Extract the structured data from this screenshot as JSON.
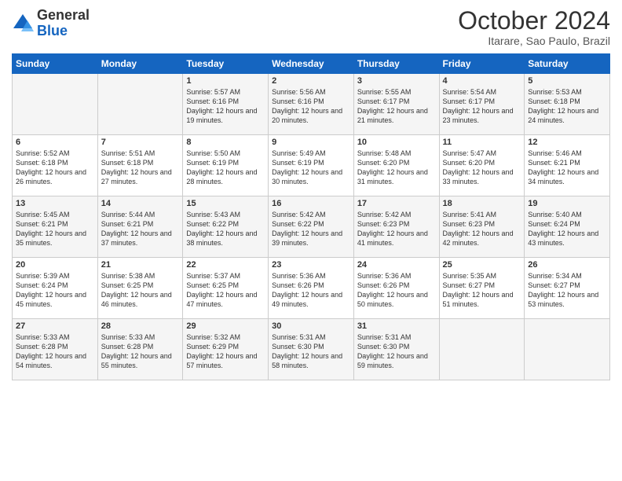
{
  "logo": {
    "general": "General",
    "blue": "Blue"
  },
  "title": "October 2024",
  "location": "Itarare, Sao Paulo, Brazil",
  "days_of_week": [
    "Sunday",
    "Monday",
    "Tuesday",
    "Wednesday",
    "Thursday",
    "Friday",
    "Saturday"
  ],
  "weeks": [
    [
      {
        "day": "",
        "text": ""
      },
      {
        "day": "",
        "text": ""
      },
      {
        "day": "1",
        "text": "Sunrise: 5:57 AM\nSunset: 6:16 PM\nDaylight: 12 hours and 19 minutes."
      },
      {
        "day": "2",
        "text": "Sunrise: 5:56 AM\nSunset: 6:16 PM\nDaylight: 12 hours and 20 minutes."
      },
      {
        "day": "3",
        "text": "Sunrise: 5:55 AM\nSunset: 6:17 PM\nDaylight: 12 hours and 21 minutes."
      },
      {
        "day": "4",
        "text": "Sunrise: 5:54 AM\nSunset: 6:17 PM\nDaylight: 12 hours and 23 minutes."
      },
      {
        "day": "5",
        "text": "Sunrise: 5:53 AM\nSunset: 6:18 PM\nDaylight: 12 hours and 24 minutes."
      }
    ],
    [
      {
        "day": "6",
        "text": "Sunrise: 5:52 AM\nSunset: 6:18 PM\nDaylight: 12 hours and 26 minutes."
      },
      {
        "day": "7",
        "text": "Sunrise: 5:51 AM\nSunset: 6:18 PM\nDaylight: 12 hours and 27 minutes."
      },
      {
        "day": "8",
        "text": "Sunrise: 5:50 AM\nSunset: 6:19 PM\nDaylight: 12 hours and 28 minutes."
      },
      {
        "day": "9",
        "text": "Sunrise: 5:49 AM\nSunset: 6:19 PM\nDaylight: 12 hours and 30 minutes."
      },
      {
        "day": "10",
        "text": "Sunrise: 5:48 AM\nSunset: 6:20 PM\nDaylight: 12 hours and 31 minutes."
      },
      {
        "day": "11",
        "text": "Sunrise: 5:47 AM\nSunset: 6:20 PM\nDaylight: 12 hours and 33 minutes."
      },
      {
        "day": "12",
        "text": "Sunrise: 5:46 AM\nSunset: 6:21 PM\nDaylight: 12 hours and 34 minutes."
      }
    ],
    [
      {
        "day": "13",
        "text": "Sunrise: 5:45 AM\nSunset: 6:21 PM\nDaylight: 12 hours and 35 minutes."
      },
      {
        "day": "14",
        "text": "Sunrise: 5:44 AM\nSunset: 6:21 PM\nDaylight: 12 hours and 37 minutes."
      },
      {
        "day": "15",
        "text": "Sunrise: 5:43 AM\nSunset: 6:22 PM\nDaylight: 12 hours and 38 minutes."
      },
      {
        "day": "16",
        "text": "Sunrise: 5:42 AM\nSunset: 6:22 PM\nDaylight: 12 hours and 39 minutes."
      },
      {
        "day": "17",
        "text": "Sunrise: 5:42 AM\nSunset: 6:23 PM\nDaylight: 12 hours and 41 minutes."
      },
      {
        "day": "18",
        "text": "Sunrise: 5:41 AM\nSunset: 6:23 PM\nDaylight: 12 hours and 42 minutes."
      },
      {
        "day": "19",
        "text": "Sunrise: 5:40 AM\nSunset: 6:24 PM\nDaylight: 12 hours and 43 minutes."
      }
    ],
    [
      {
        "day": "20",
        "text": "Sunrise: 5:39 AM\nSunset: 6:24 PM\nDaylight: 12 hours and 45 minutes."
      },
      {
        "day": "21",
        "text": "Sunrise: 5:38 AM\nSunset: 6:25 PM\nDaylight: 12 hours and 46 minutes."
      },
      {
        "day": "22",
        "text": "Sunrise: 5:37 AM\nSunset: 6:25 PM\nDaylight: 12 hours and 47 minutes."
      },
      {
        "day": "23",
        "text": "Sunrise: 5:36 AM\nSunset: 6:26 PM\nDaylight: 12 hours and 49 minutes."
      },
      {
        "day": "24",
        "text": "Sunrise: 5:36 AM\nSunset: 6:26 PM\nDaylight: 12 hours and 50 minutes."
      },
      {
        "day": "25",
        "text": "Sunrise: 5:35 AM\nSunset: 6:27 PM\nDaylight: 12 hours and 51 minutes."
      },
      {
        "day": "26",
        "text": "Sunrise: 5:34 AM\nSunset: 6:27 PM\nDaylight: 12 hours and 53 minutes."
      }
    ],
    [
      {
        "day": "27",
        "text": "Sunrise: 5:33 AM\nSunset: 6:28 PM\nDaylight: 12 hours and 54 minutes."
      },
      {
        "day": "28",
        "text": "Sunrise: 5:33 AM\nSunset: 6:28 PM\nDaylight: 12 hours and 55 minutes."
      },
      {
        "day": "29",
        "text": "Sunrise: 5:32 AM\nSunset: 6:29 PM\nDaylight: 12 hours and 57 minutes."
      },
      {
        "day": "30",
        "text": "Sunrise: 5:31 AM\nSunset: 6:30 PM\nDaylight: 12 hours and 58 minutes."
      },
      {
        "day": "31",
        "text": "Sunrise: 5:31 AM\nSunset: 6:30 PM\nDaylight: 12 hours and 59 minutes."
      },
      {
        "day": "",
        "text": ""
      },
      {
        "day": "",
        "text": ""
      }
    ]
  ]
}
